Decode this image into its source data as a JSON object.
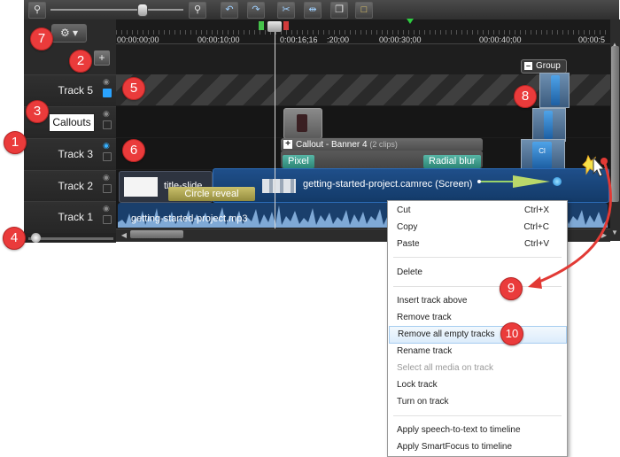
{
  "toolbar": {
    "buttons": [
      "zoom-out",
      "zoom-in",
      "undo",
      "redo",
      "cut",
      "split",
      "copy",
      "paste"
    ]
  },
  "ruler": {
    "labels": [
      "00:00:00;00",
      "00:00:10;00",
      "0:00:16;16",
      ":20;00",
      "00:00:30;00",
      "00:00:40;00",
      "00:00:5"
    ]
  },
  "tracks": [
    {
      "name": "Track 5",
      "eye": "visible",
      "locked": true
    },
    {
      "name": "Callouts",
      "eye": "visible",
      "locked": false
    },
    {
      "name": "Track 3",
      "eye": "hidden",
      "locked": false
    },
    {
      "name": "Track 2",
      "eye": "visible",
      "locked": false
    },
    {
      "name": "Track 1",
      "eye": "visible",
      "locked": false
    }
  ],
  "clips": {
    "group": "Group",
    "callout_title": "Callout - Banner 4",
    "callout_sub": "(2 clips)",
    "fx_pixel": "Pixel",
    "fx_radial": "Radial blur",
    "title_clip": "title-slide",
    "circle_reveal": "Circle reveal",
    "screen_clip": "getting-started-project.camrec (Screen)",
    "audio_clip": "getting-started-project.mp3",
    "group_clip_c_text": "Cl"
  },
  "menu": {
    "items": [
      {
        "label": "Cut",
        "shortcut": "Ctrl+X"
      },
      {
        "label": "Copy",
        "shortcut": "Ctrl+C"
      },
      {
        "label": "Paste",
        "shortcut": "Ctrl+V"
      },
      {
        "label": "Delete",
        "shortcut": ""
      },
      {
        "label": "Insert track above",
        "shortcut": ""
      },
      {
        "label": "Remove track",
        "shortcut": ""
      },
      {
        "label": "Remove all empty tracks",
        "shortcut": "",
        "highlighted": true
      },
      {
        "label": "Rename track",
        "shortcut": ""
      },
      {
        "label": "Select all media on track",
        "shortcut": "",
        "disabled": true
      },
      {
        "label": "Lock track",
        "shortcut": ""
      },
      {
        "label": "Turn on track",
        "shortcut": ""
      },
      {
        "label": "Apply speech-to-text to timeline",
        "shortcut": ""
      },
      {
        "label": "Apply SmartFocus to timeline",
        "shortcut": ""
      }
    ]
  },
  "badges": [
    "1",
    "2",
    "3",
    "4",
    "5",
    "6",
    "7",
    "8",
    "9",
    "10"
  ],
  "colors": {
    "badge": "#ea3b3b",
    "accent_blue": "#2aa3ff",
    "annotation_arrow": "#e23a35",
    "highlight": "#dcecfb"
  }
}
